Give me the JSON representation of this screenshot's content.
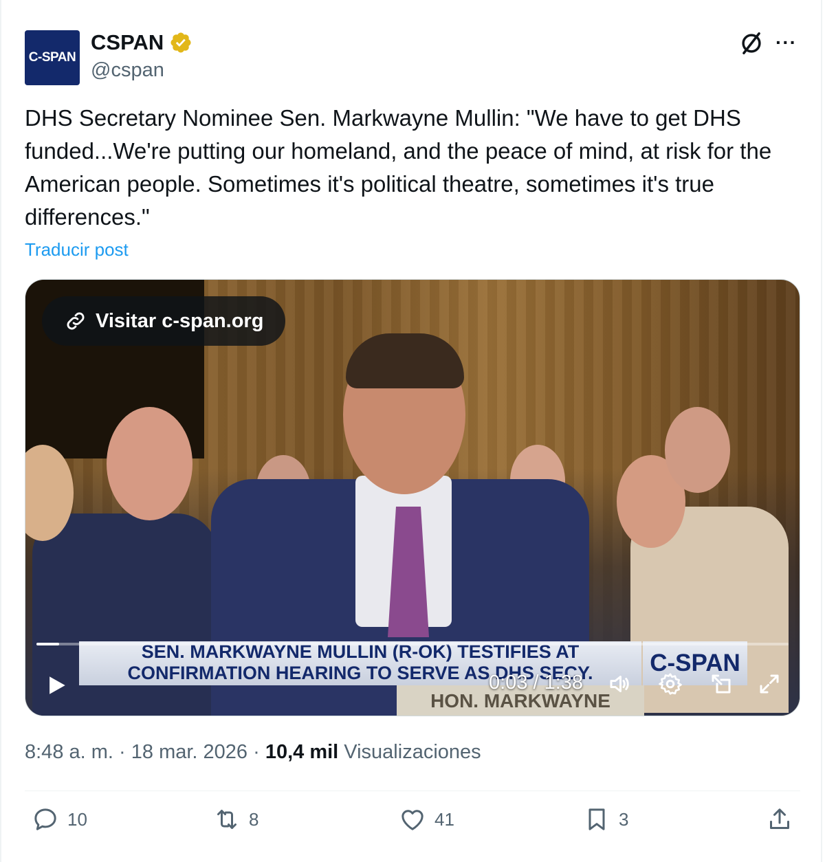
{
  "author": {
    "avatar_text": "C-SPAN",
    "name": "CSPAN",
    "handle": "@cspan"
  },
  "post": {
    "text": "DHS Secretary Nominee Sen. Markwayne Mullin: \"We have to get DHS funded...We're putting our homeland, and the peace of mind, at risk for the American people. Sometimes it's political theatre, sometimes it's true differences.\"",
    "translate_label": "Traducir post"
  },
  "video": {
    "visit_label": "Visitar c-span.org",
    "chyron_line1": "SEN. MARKWAYNE MULLIN (R-OK) TESTIFIES AT",
    "chyron_line2": "CONFIRMATION HEARING TO SERVE AS DHS SECY.",
    "chyron_logo": "C-SPAN",
    "nameplate": "HON. MARKWAYNE MULLIN",
    "time_display": "0:03 / 1:38",
    "progress_fraction": 0.03
  },
  "meta": {
    "time": "8:48 a. m.",
    "sep1": " · ",
    "date": "18 mar. 2026",
    "sep2": " · ",
    "views_count": "10,4 mil",
    "views_label": " Visualizaciones"
  },
  "actions": {
    "replies": "10",
    "reposts": "8",
    "likes": "41",
    "bookmarks": "3"
  },
  "colors": {
    "accent": "#1d9bf0",
    "secondary_text": "#536471",
    "cspan_blue": "#13296b",
    "verified_gold": "#e2b719"
  }
}
